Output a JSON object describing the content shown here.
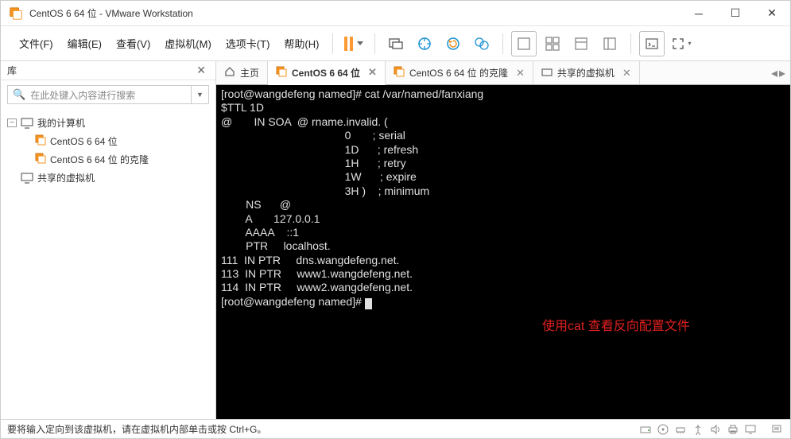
{
  "window": {
    "title": "CentOS 6 64 位 - VMware Workstation"
  },
  "menu": {
    "file": "文件(F)",
    "edit": "编辑(E)",
    "view": "查看(V)",
    "vm": "虚拟机(M)",
    "tabs": "选项卡(T)",
    "help": "帮助(H)"
  },
  "sidebar": {
    "title": "库",
    "search_placeholder": "在此处键入内容进行搜索",
    "root": "我的计算机",
    "items": [
      "CentOS 6 64 位",
      "CentOS 6 64 位 的克隆",
      "共享的虚拟机"
    ]
  },
  "tabs": {
    "home": "主页",
    "items": [
      "CentOS 6 64 位",
      "CentOS 6 64 位 的克隆",
      "共享的虚拟机"
    ]
  },
  "terminal": {
    "lines": [
      "[root@wangdefeng named]# cat /var/named/fanxiang",
      "$TTL 1D",
      "@       IN SOA  @ rname.invalid. (",
      "                                        0       ; serial",
      "                                        1D      ; refresh",
      "                                        1H      ; retry",
      "                                        1W      ; expire",
      "                                        3H )    ; minimum",
      "        NS      @",
      "        A       127.0.0.1",
      "        AAAA    ::1",
      "        PTR     localhost.",
      "111  IN PTR     dns.wangdefeng.net.",
      "113  IN PTR     www1.wangdefeng.net.",
      "114  IN PTR     www2.wangdefeng.net.",
      "[root@wangdefeng named]# "
    ],
    "annotation": "使用cat 查看反向配置文件"
  },
  "statusbar": {
    "text": "要将输入定向到该虚拟机，请在虚拟机内部单击或按 Ctrl+G。"
  }
}
